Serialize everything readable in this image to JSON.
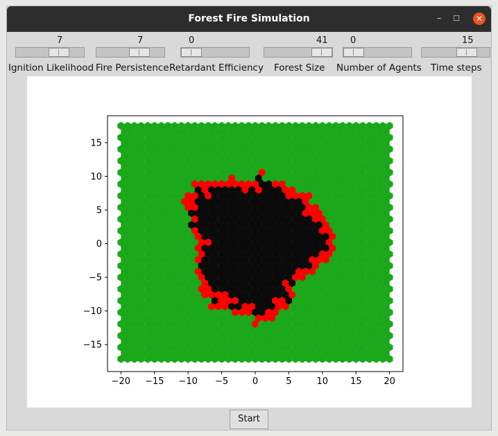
{
  "window": {
    "title": "Forest Fire Simulation",
    "minimize": "–",
    "maximize": "☐",
    "close": "✕"
  },
  "sliders": [
    {
      "label": "Ignition Likelihood",
      "value": "7"
    },
    {
      "label": "Fire Persistence",
      "value": "7"
    },
    {
      "label": "Retardant Efficiency",
      "value": "0"
    },
    {
      "label": "Forest Size",
      "value": "41"
    },
    {
      "label": "Number of Agents",
      "value": "0"
    },
    {
      "label": "Time steps",
      "value": "15"
    }
  ],
  "buttons": {
    "start": "Start"
  },
  "colors": {
    "tree": "#1aa81a",
    "burning": "#ff0000",
    "burnt": "#0a0a0a",
    "close_button": "#e95420"
  },
  "chart_data": {
    "type": "hexgrid",
    "xlim": [
      -22,
      22
    ],
    "ylim": [
      -19,
      19
    ],
    "xticks": [
      -20,
      -15,
      -10,
      -5,
      0,
      5,
      10,
      15,
      20
    ],
    "yticks": [
      15,
      10,
      5,
      0,
      -5,
      -10,
      -15
    ],
    "xtick_labels": [
      "−20",
      "−15",
      "−10",
      "−5",
      "0",
      "5",
      "10",
      "15",
      "20"
    ],
    "ytick_labels": [
      "15",
      "10",
      "5",
      "0",
      "−5",
      "−10",
      "−15"
    ],
    "grid_extent": {
      "x": [
        -20,
        20
      ],
      "y": [
        -17.5,
        17.5
      ]
    },
    "burnt_region_radius": 10.5,
    "fire_front_width": 1.5
  }
}
